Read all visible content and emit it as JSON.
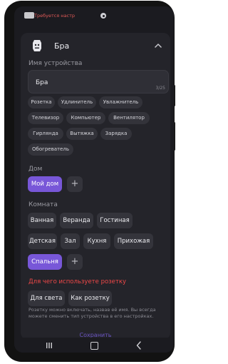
{
  "status_bar": {
    "warning": "Требуется настр"
  },
  "header": {
    "device_name": "Бра"
  },
  "device_name_section": {
    "label": "Имя устройства",
    "value": "Бра",
    "counter": "3/25"
  },
  "device_types": [
    "Розетка",
    "Удлинитель",
    "Увлажнитель",
    "Телевизор",
    "Компьютер",
    "Вентилятор",
    "Гирлянда",
    "Вытяжка",
    "Зарядка",
    "Обогреватель"
  ],
  "home_section": {
    "label": "Дом",
    "items": [
      "Мой дом"
    ],
    "selected": "Мой дом",
    "add": "+"
  },
  "room_section": {
    "label": "Комната",
    "items": [
      "Ванная",
      "Веранда",
      "Гостиная",
      "Детская",
      "Зал",
      "Кухня",
      "Прихожая",
      "Спальня"
    ],
    "selected": "Спальня",
    "add": "+"
  },
  "purpose_section": {
    "title": "Для чего используете розетку",
    "options": [
      "Для света",
      "Как розетку"
    ],
    "hint": "Розетку можно включать, назвав её имя. Вы всегда можете сменить тип устройства в его настройках."
  },
  "save_label": "Сохранить",
  "colors": {
    "accent": "#7857d8",
    "warning": "#f04848",
    "sheet": "#24242a",
    "background": "#1b1b20"
  },
  "icons": {
    "device": "outlet-device-icon",
    "collapse": "chevron-up-icon",
    "nav_recent": "recent-apps-icon",
    "nav_home": "home-icon",
    "nav_back": "back-icon"
  }
}
